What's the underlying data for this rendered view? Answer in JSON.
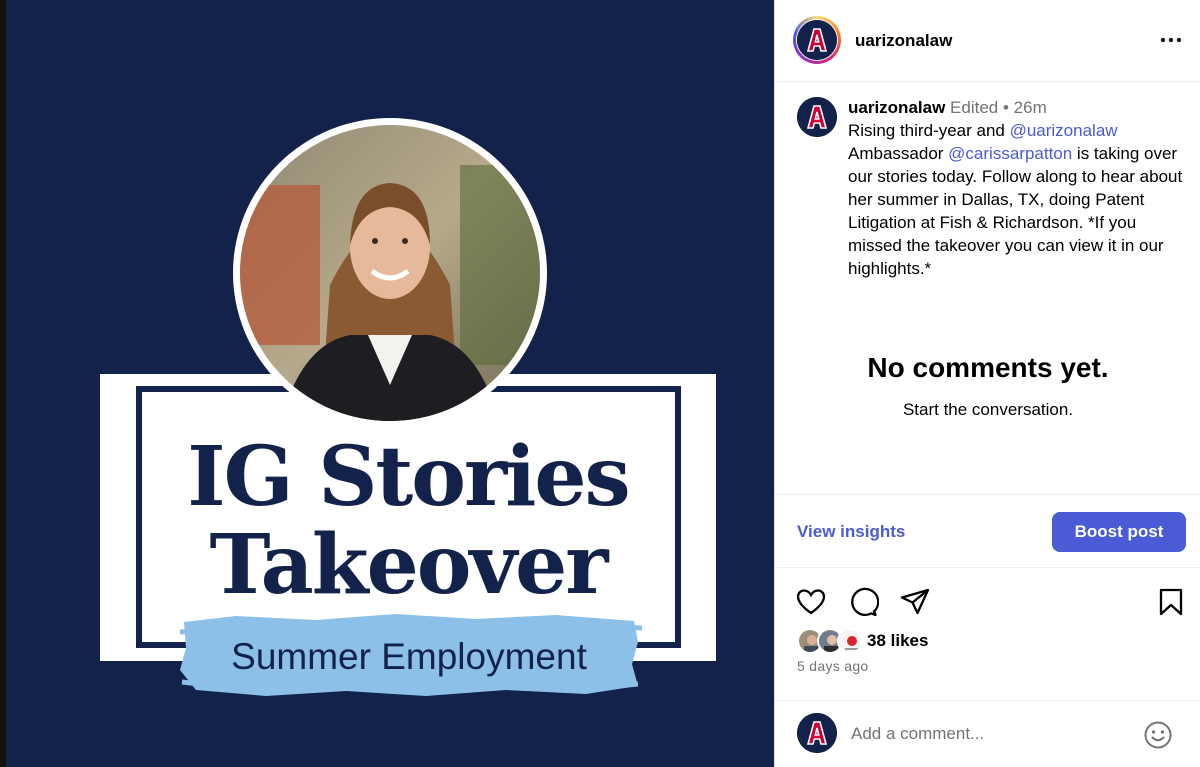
{
  "media": {
    "title_line1": "IG Stories",
    "title_line2": "Takeover",
    "subtitle": "Summer Employment",
    "colors": {
      "navy": "#13224a",
      "brush_blue": "#8cc0e8",
      "white": "#ffffff"
    }
  },
  "header": {
    "username": "uarizonalaw",
    "avatar_icon": "university-a-logo",
    "more_icon": "more-horizontal-icon"
  },
  "caption": {
    "username": "uarizonalaw",
    "edited_label": "Edited",
    "separator": "•",
    "time_ago": "26m",
    "text_part1": "Rising third-year and ",
    "mention1": "@uarizonalaw",
    "text_part2": " Ambassador ",
    "mention2": "@carissarpatton",
    "text_part3": " is taking over our stories today. Follow along to hear about her summer in Dallas, TX, doing Patent Litigation at Fish & Richardson. *If you missed the takeover you can view it in our highlights.*"
  },
  "comments": {
    "empty_title": "No comments yet.",
    "empty_subtitle": "Start the conversation."
  },
  "insights": {
    "view_insights_label": "View insights",
    "boost_label": "Boost post"
  },
  "actions": {
    "like_icon": "heart-icon",
    "comment_icon": "comment-icon",
    "share_icon": "paper-plane-icon",
    "save_icon": "bookmark-icon"
  },
  "likes": {
    "count_label": "38 likes",
    "date_label": "5 days ago"
  },
  "comment_box": {
    "placeholder": "Add a comment...",
    "emoji_icon": "smiley-icon"
  },
  "colors": {
    "accent_blue": "#4a5bd5",
    "muted_text": "#737373",
    "divider": "#efefef"
  }
}
